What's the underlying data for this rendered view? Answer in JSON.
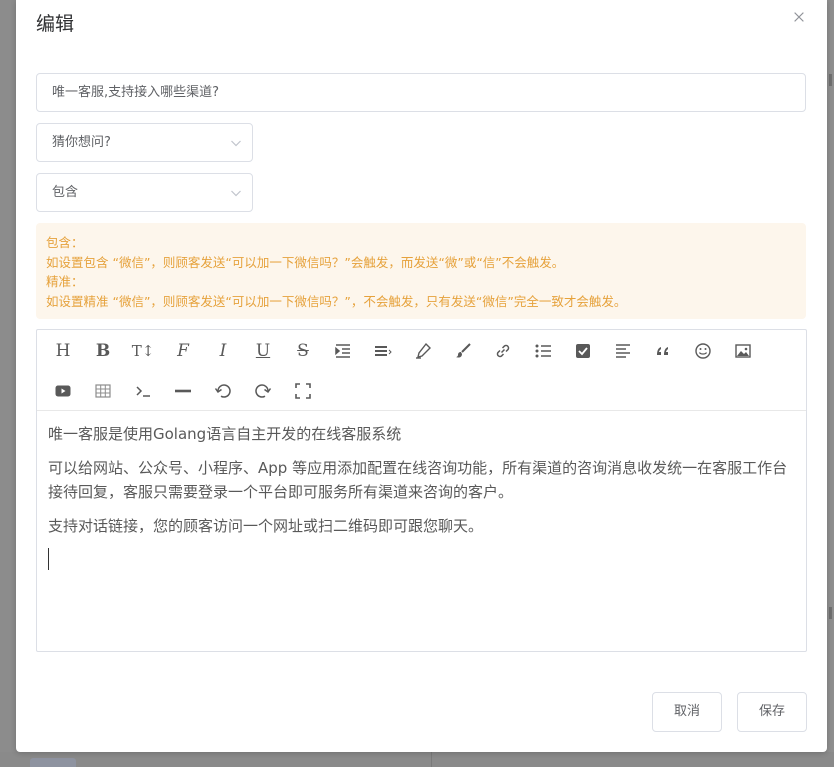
{
  "dialog": {
    "title": "编辑"
  },
  "form": {
    "question_value": "唯一客服,支持接入哪些渠道?",
    "guess_select": "猜你想问?",
    "match_select": "包含"
  },
  "hint": {
    "line1": "包含：",
    "line2": "如设置包含 “微信”，则顾客发送“可以加一下微信吗？”会触发，而发送“微”或“信”不会触发。",
    "line3": "精准：",
    "line4": "如设置精准 “微信”，则顾客发送“可以加一下微信吗？”，不会触发，只有发送“微信”完全一致才会触发。"
  },
  "toolbar": {
    "heading": "H",
    "bold": "B",
    "font_size": "T↕",
    "font_family": "F",
    "italic": "I",
    "underline": "U",
    "strike": "S"
  },
  "editor": {
    "paragraphs": [
      "唯一客服是使用Golang语言自主开发的在线客服系统",
      "可以给网站、公众号、小程序、App 等应用添加配置在线咨询功能，所有渠道的咨询消息收发统一在客服工作台接待回复，客服只需要登录一个平台即可服务所有渠道来咨询的客户。",
      "支持对话链接，您的顾客访问一个网址或扫二维码即可跟您聊天。"
    ]
  },
  "footer": {
    "cancel_label": "取消",
    "save_label": "保存"
  },
  "colors": {
    "hint_text": "#e6a23c",
    "hint_bg": "#fdf6ec",
    "border": "#dcdfe6"
  }
}
